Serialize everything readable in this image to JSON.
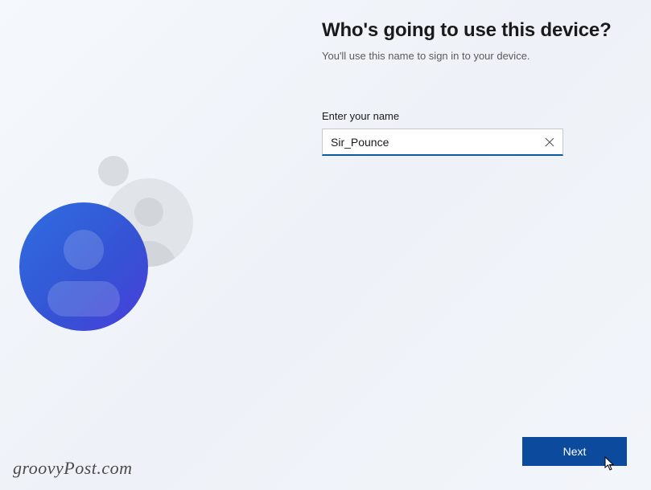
{
  "heading": "Who's going to use this device?",
  "subtitle": "You'll use this name to sign in to your device.",
  "form": {
    "name_label": "Enter your name",
    "name_value": "Sir_Pounce"
  },
  "buttons": {
    "next": "Next"
  },
  "watermark": "groovyPost.com",
  "colors": {
    "accent": "#0c4a9e",
    "input_focus": "#0c59a4"
  }
}
